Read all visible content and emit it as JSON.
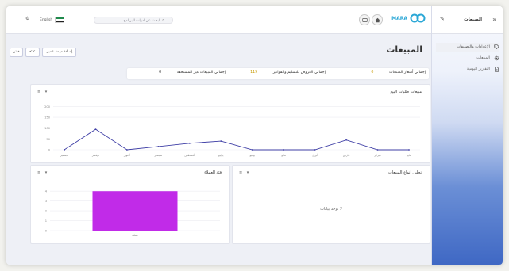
{
  "header": {
    "brand": "MARA",
    "search_placeholder": "ابحث عن ادوات البرنامج",
    "lang_label": "English",
    "lang_short": "EN"
  },
  "page": {
    "title": "المبيعات",
    "btn_add": "إضافة مهمة عميل",
    "btn_filter": "فلتر",
    "btn_arrow": "<<"
  },
  "filters": [
    {
      "label": "إجمالي أسعار المنتجات",
      "value": "0"
    },
    {
      "label": "إجمالي العروض للتسليم والفواتير",
      "value": "119"
    },
    {
      "label": "إجمالي المبيعات غير المستحقة",
      "value": "0"
    }
  ],
  "cards": {
    "line": {
      "title": "مبيعات طلبات البيع",
      "tools": "≡ ▾"
    },
    "pie": {
      "title": "تحليل أنواع المبيعات",
      "tools": "≡ ▾",
      "empty": "لا توجد بيانات"
    },
    "bar": {
      "title": "فئة العملاء",
      "tools": "≡ ▾"
    }
  },
  "chart_data": [
    {
      "type": "line",
      "title": "مبيعات طلبات البيع",
      "categories": [
        "يناير",
        "فبراير",
        "مارس",
        "أبريل",
        "مايو",
        "يونيو",
        "يوليو",
        "أغسطس",
        "سبتمبر",
        "أكتوبر",
        "نوفمبر",
        "ديسمبر"
      ],
      "values": [
        0,
        0,
        45,
        0,
        0,
        0,
        40,
        30,
        15,
        0,
        95,
        0
      ],
      "ylim": [
        0,
        220
      ],
      "yticks": [
        0,
        50,
        100,
        150,
        200
      ]
    },
    {
      "type": "bar",
      "title": "فئة العملاء",
      "categories": [
        "عملاء"
      ],
      "values": [
        4
      ],
      "ylim": [
        0,
        4.5
      ],
      "yticks": [
        0,
        1,
        2,
        3,
        4
      ],
      "bar_color": "#c12be8"
    }
  ],
  "sidebar": {
    "title": "المبيعات",
    "items": [
      {
        "label": "الإعدادات والتصنيفات",
        "icon": "tag-icon"
      },
      {
        "label": "المبيعات",
        "icon": "gear-icon"
      },
      {
        "label": "التقارير اليومية",
        "icon": "document-icon"
      }
    ]
  },
  "colors": {
    "accent": "#2aa7d6",
    "line_color": "#3f3fa6",
    "sidebar_dark": "#3f68c4"
  }
}
